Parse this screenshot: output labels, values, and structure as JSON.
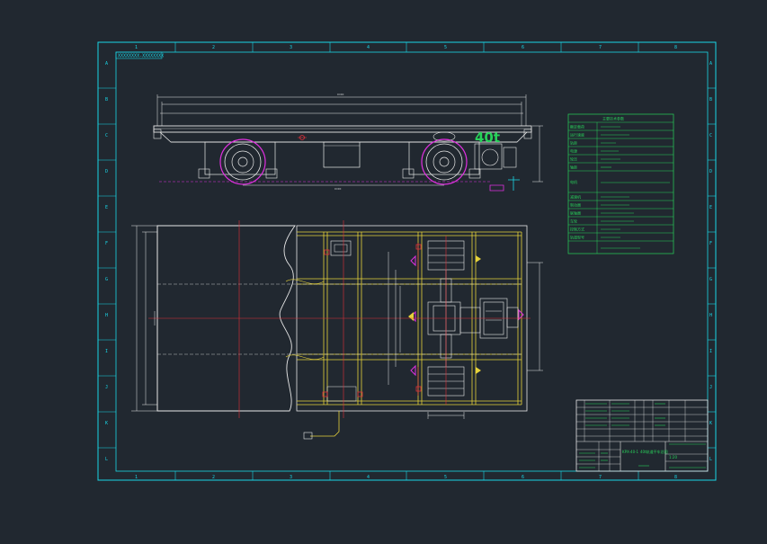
{
  "drawing": {
    "top_label": "XXXXXXXX-XXXXXXXX",
    "capacity_label": "40t",
    "zone_columns": [
      "1",
      "2",
      "3",
      "4",
      "5",
      "6",
      "7",
      "8"
    ],
    "zone_rows": [
      "A",
      "B",
      "C",
      "D",
      "E",
      "F",
      "G",
      "H",
      "I",
      "J",
      "K",
      "L"
    ],
    "spec_table_title": "主要技术参数",
    "spec_rows": [
      "额定载荷",
      "运行速度",
      "轨距",
      "电源",
      "轮压",
      "轴距",
      "电机",
      "减速机",
      "制动器",
      "联轴器",
      "车轮",
      "控制方式",
      "轨道型号"
    ],
    "title_block": {
      "drawing_no": "KPX-40-1",
      "drawing_name": "40t轨道平车总图",
      "scale": "1:20"
    },
    "colors": {
      "background": "#212830",
      "frame": "#19d6e6",
      "outline": "#e8e8e8",
      "structure": "#e6d23a",
      "text": "#28d25a",
      "centerline": "#e0303a",
      "hardware": "#e030e0"
    }
  }
}
